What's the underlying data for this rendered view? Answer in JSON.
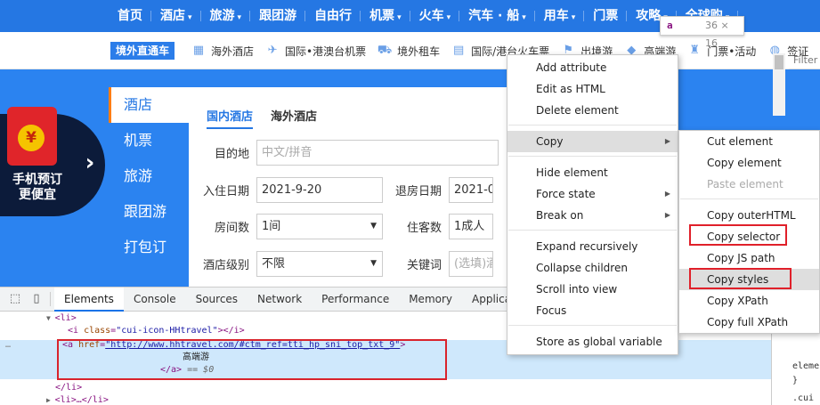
{
  "top_nav": {
    "items": [
      {
        "label": "首页",
        "caret": false
      },
      {
        "label": "酒店",
        "caret": true
      },
      {
        "label": "旅游",
        "caret": true
      },
      {
        "label": "跟团游",
        "caret": false
      },
      {
        "label": "自由行",
        "caret": false
      },
      {
        "label": "机票",
        "caret": true
      },
      {
        "label": "火车",
        "caret": true
      },
      {
        "label": "汽车 · 船",
        "caret": true
      },
      {
        "label": "用车",
        "caret": true
      },
      {
        "label": "门票",
        "caret": false
      },
      {
        "label": "攻略",
        "caret": true
      },
      {
        "label": "全球购",
        "caret": true
      }
    ],
    "caret_glyph": "▾"
  },
  "sub_bar": {
    "badge": "境外直通车",
    "items": [
      {
        "label": "海外酒店",
        "icon": "building-icon"
      },
      {
        "label": "国际•港澳台机票",
        "icon": "plane-icon"
      },
      {
        "label": "境外租车",
        "icon": "car-icon"
      },
      {
        "label": "国际/港台火车票",
        "icon": "train-icon"
      },
      {
        "label": "出境游",
        "icon": "flag-icon"
      },
      {
        "label": "高端游",
        "icon": "diamond-icon"
      },
      {
        "label": "门票•活动",
        "icon": "ticket-icon"
      },
      {
        "label": "签证",
        "icon": "globe-icon"
      }
    ]
  },
  "promo": {
    "coin": "¥",
    "text_line1": "手机预订",
    "text_line2": "更便宜",
    "arrow": "›"
  },
  "side_menu": {
    "items": [
      {
        "label": "酒店",
        "active": true
      },
      {
        "label": "机票",
        "active": false
      },
      {
        "label": "旅游",
        "active": false
      },
      {
        "label": "跟团游",
        "active": false
      },
      {
        "label": "打包订",
        "active": false
      }
    ]
  },
  "search_panel": {
    "tabs": [
      {
        "label": "国内酒店",
        "active": true
      },
      {
        "label": "海外酒店",
        "active": false
      }
    ],
    "destination": {
      "label": "目的地",
      "placeholder": "中文/拼音"
    },
    "checkin": {
      "label": "入住日期",
      "value": "2021-9-20"
    },
    "checkout": {
      "label": "退房日期",
      "value": "2021-0"
    },
    "rooms": {
      "label": "房间数",
      "value": "1间"
    },
    "guests": {
      "label": "住客数",
      "value": "1成人"
    },
    "star": {
      "label": "酒店级别",
      "value": "不限"
    },
    "keyword": {
      "label": "关键词",
      "placeholder": "(选填)酒"
    },
    "dropdown_glyph": "▼"
  },
  "devtools": {
    "tabs": [
      "Elements",
      "Console",
      "Sources",
      "Network",
      "Performance",
      "Memory",
      "Application"
    ],
    "active_tab": "Elements",
    "code": {
      "line1": "<li>",
      "line2_tag_open": "<i ",
      "line2_attr": "class",
      "line2_val": "\"cui-icon-HHtravel\"",
      "line2_close": "></i>",
      "line3_tag": "<a ",
      "line3_attr": "href",
      "line3_val": "\"http://www.hhtravel.com/#ctm_ref=tti_hp_sni_top_txt_9\"",
      "line3_close": ">",
      "line4_text": "高端游",
      "line5_close": "</a>",
      "line5_eq": " == $0",
      "line6": "</li>",
      "line7": "<li>…</li>",
      "dots": "…"
    },
    "right_panel": {
      "filter": "Filter",
      "line1": "eleme",
      "line2": "}",
      "line3": ".cui"
    }
  },
  "tooltip": {
    "tag": "a",
    "size": "36 × 16"
  },
  "context_menu": {
    "items": [
      "Add attribute",
      "Edit as HTML",
      "Delete element",
      "Copy",
      "Hide element",
      "Force state",
      "Break on",
      "Expand recursively",
      "Collapse children",
      "Scroll into view",
      "Focus",
      "Store as global variable"
    ]
  },
  "copy_submenu": {
    "items": [
      "Cut element",
      "Copy element",
      "Paste element",
      "Copy outerHTML",
      "Copy selector",
      "Copy JS path",
      "Copy styles",
      "Copy XPath",
      "Copy full XPath"
    ]
  },
  "colors": {
    "nav_blue": "#2577e3",
    "banner_blue": "#2b83f0",
    "highlight_red": "#e0202a"
  }
}
